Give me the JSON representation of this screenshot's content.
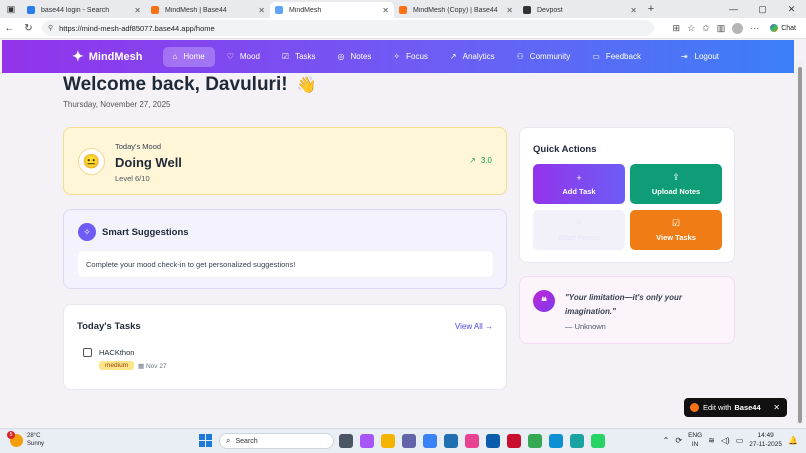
{
  "browser": {
    "tabs": [
      {
        "title": "base44 login - Search",
        "color": "#2b7de9",
        "active": false
      },
      {
        "title": "MindMesh | Base44",
        "color": "#f97316",
        "active": false
      },
      {
        "title": "MindMesh",
        "color": "#60a5fa",
        "active": true
      },
      {
        "title": "MindMesh (Copy) | Base44",
        "color": "#f97316",
        "active": false
      },
      {
        "title": "Devpost",
        "color": "#333333",
        "active": false
      }
    ],
    "url": "https://mind-mesh-adf85077.base44.app/home",
    "chat_label": "Chat"
  },
  "nav": {
    "brand": "MindMesh",
    "items": [
      {
        "label": "Home",
        "icon": "⌂"
      },
      {
        "label": "Mood",
        "icon": "♡"
      },
      {
        "label": "Tasks",
        "icon": "☑"
      },
      {
        "label": "Notes",
        "icon": "◎"
      },
      {
        "label": "Focus",
        "icon": "✧"
      },
      {
        "label": "Analytics",
        "icon": "↗"
      },
      {
        "label": "Community",
        "icon": "⚇"
      },
      {
        "label": "Feedback",
        "icon": "▭"
      }
    ],
    "logout": "Logout"
  },
  "header": {
    "welcome": "Welcome back, Davuluri!",
    "wave": "👋",
    "date": "Thursday, November 27, 2025"
  },
  "mood": {
    "label": "Today's Mood",
    "value": "Doing Well",
    "level": "Level 6/10",
    "trend": "3.0"
  },
  "suggestions": {
    "title": "Smart Suggestions",
    "message": "Complete your mood check-in to get personalized suggestions!"
  },
  "tasks": {
    "title": "Today's Tasks",
    "view_all": "View All →",
    "items": [
      {
        "name": "HACKthon",
        "priority": "medium",
        "due": "Nov 27"
      }
    ]
  },
  "quick_actions": {
    "title": "Quick Actions",
    "add_task": "Add Task",
    "upload_notes": "Upload Notes",
    "start_focus": "Start Focus",
    "view_tasks": "View Tasks"
  },
  "quote": {
    "text": "\"Your limitation—it's only your imagination.\"",
    "author": "— Unknown"
  },
  "edit_badge": {
    "prefix": "Edit with",
    "brand": "Base44"
  },
  "taskbar": {
    "temp": "28°C",
    "condition": "Sunny",
    "weather_badge": "5",
    "search": "Search",
    "lang_line1": "ENG",
    "lang_line2": "IN",
    "time": "14:49",
    "date": "27-11-2025"
  }
}
